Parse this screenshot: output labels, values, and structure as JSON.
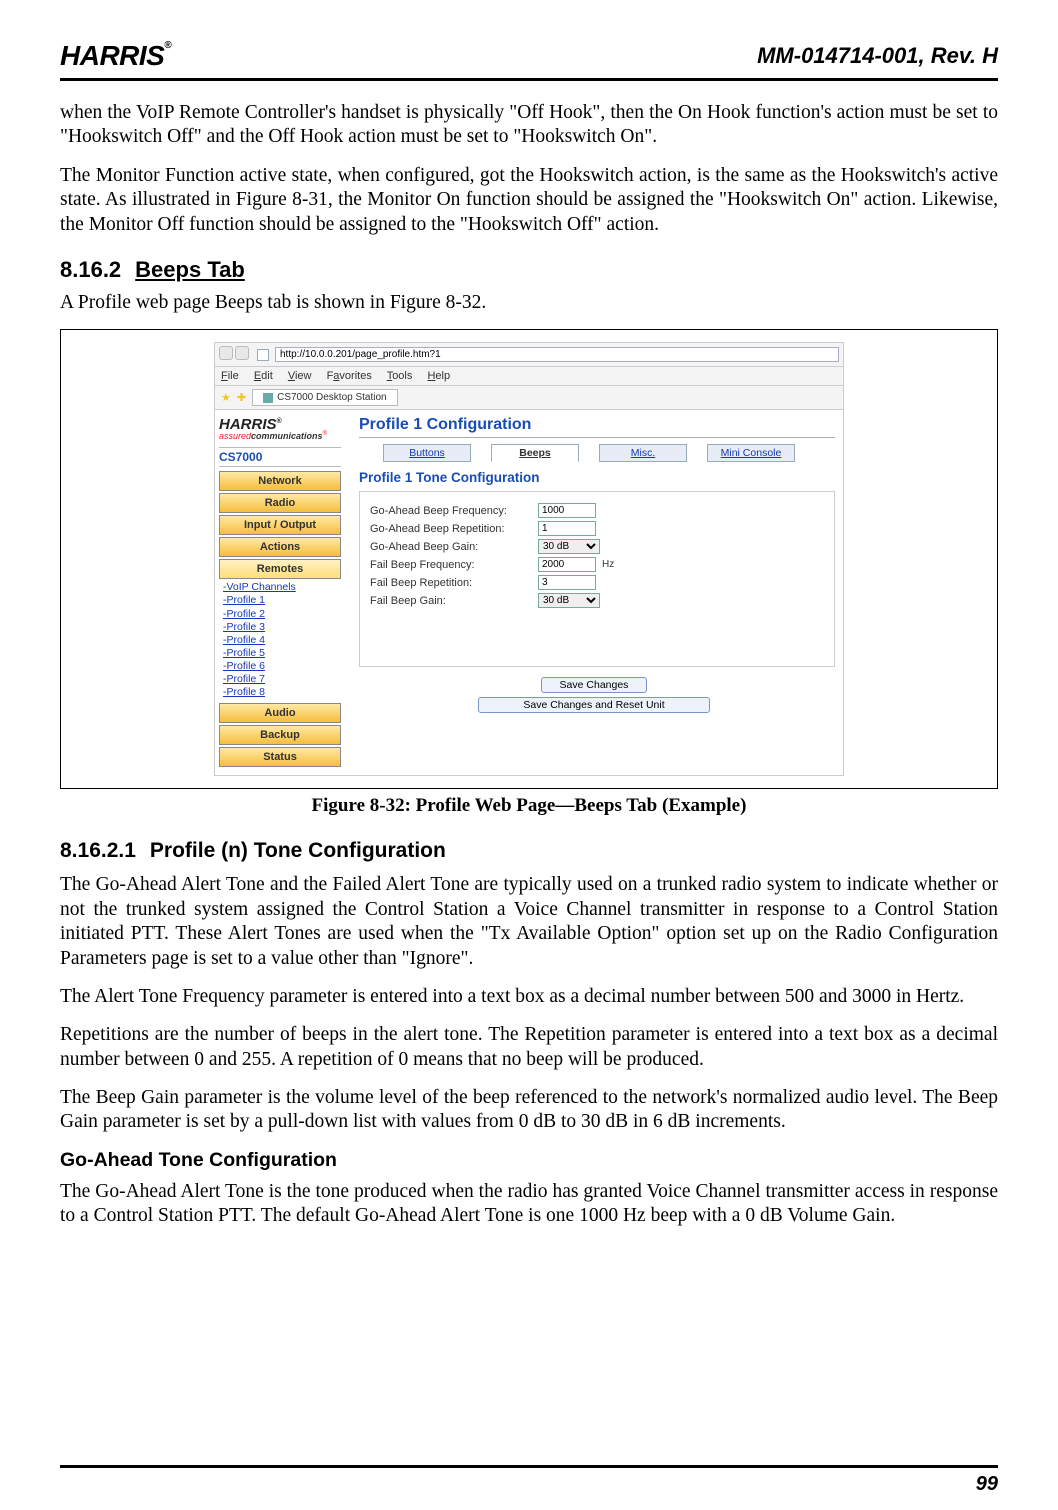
{
  "header": {
    "logo_text": "HARRIS",
    "doc_id": "MM-014714-001, Rev. H"
  },
  "paragraphs": {
    "p1": "when the VoIP Remote Controller's handset is physically \"Off Hook\", then the On Hook function's action must be set to \"Hookswitch Off\" and the Off Hook action must be set to \"Hookswitch On\".",
    "p2": "The Monitor Function active state, when configured, got the Hookswitch action, is the same as the Hookswitch's active state.  As illustrated in Figure 8-31, the Monitor On function should be assigned the \"Hookswitch On\" action.  Likewise, the Monitor Off function should be assigned to the \"Hookswitch Off\" action.",
    "p3": "A Profile web page Beeps tab is shown in Figure 8-32.",
    "p4": "The Go-Ahead Alert Tone and the Failed Alert Tone are typically used on a trunked radio system to indicate whether or not the trunked system assigned the Control Station a Voice Channel transmitter in response to a Control Station initiated PTT.  These Alert Tones are used when the \"Tx Available Option\" option set up on the Radio Configuration Parameters page is set to a value other than \"Ignore\".",
    "p5": "The Alert Tone Frequency parameter is entered into a text box as a decimal number between 500 and 3000 in Hertz.",
    "p6": "Repetitions are the number of beeps in the alert tone.  The Repetition parameter is entered into a text box as a decimal number between 0 and 255.  A repetition of 0 means that no beep will be produced.",
    "p7": "The Beep Gain parameter is the volume level of the beep referenced to the network's normalized audio level.  The Beep Gain parameter is set by a pull-down list with values from 0 dB to 30 dB in 6 dB increments.",
    "p8": "The Go-Ahead Alert Tone is the tone produced when the radio has granted Voice Channel transmitter access in response to a Control Station PTT.  The default Go-Ahead Alert Tone is one 1000 Hz beep with a 0 dB Volume Gain."
  },
  "sections": {
    "s1_num": "8.16.2",
    "s1_title": "Beeps Tab",
    "s2_num": "8.16.2.1",
    "s2_title": "Profile (n) Tone Configuration",
    "h_goahead": "Go-Ahead Tone Configuration"
  },
  "figure": {
    "caption": "Figure 8-32:  Profile Web Page—Beeps Tab (Example)",
    "url": "http://10.0.0.201/page_profile.htm?1",
    "menubar": [
      "File",
      "Edit",
      "View",
      "Favorites",
      "Tools",
      "Help"
    ],
    "browser_tab": "CS7000 Desktop Station",
    "brand": "HARRIS",
    "tagline_red": "assured",
    "tagline_rest": "communications",
    "product": "CS7000",
    "nav": [
      "Network",
      "Radio",
      "Input / Output",
      "Actions",
      "Remotes"
    ],
    "sublinks": [
      "VoIP Channels",
      "Profile 1",
      "Profile 2",
      "Profile 3",
      "Profile 4",
      "Profile 5",
      "Profile 6",
      "Profile 7",
      "Profile 8"
    ],
    "nav2": [
      "Audio",
      "Backup",
      "Status"
    ],
    "page_title": "Profile 1 Configuration",
    "tabs": [
      "Buttons",
      "Beeps",
      "Misc.",
      "Mini Console"
    ],
    "subtitle": "Profile 1 Tone Configuration",
    "fields": {
      "ga_freq_label": "Go-Ahead Beep Frequency:",
      "ga_freq_value": "1000",
      "ga_rep_label": "Go-Ahead Beep Repetition:",
      "ga_rep_value": "1",
      "ga_gain_label": "Go-Ahead Beep Gain:",
      "ga_gain_value": "30 dB",
      "fail_freq_label": "Fail Beep Frequency:",
      "fail_freq_value": "2000",
      "fail_freq_unit": "Hz",
      "fail_rep_label": "Fail Beep Repetition:",
      "fail_rep_value": "3",
      "fail_gain_label": "Fail Beep Gain:",
      "fail_gain_value": "30 dB"
    },
    "buttons": {
      "save": "Save Changes",
      "save_reset": "Save Changes and Reset Unit"
    }
  },
  "page_number": "99"
}
